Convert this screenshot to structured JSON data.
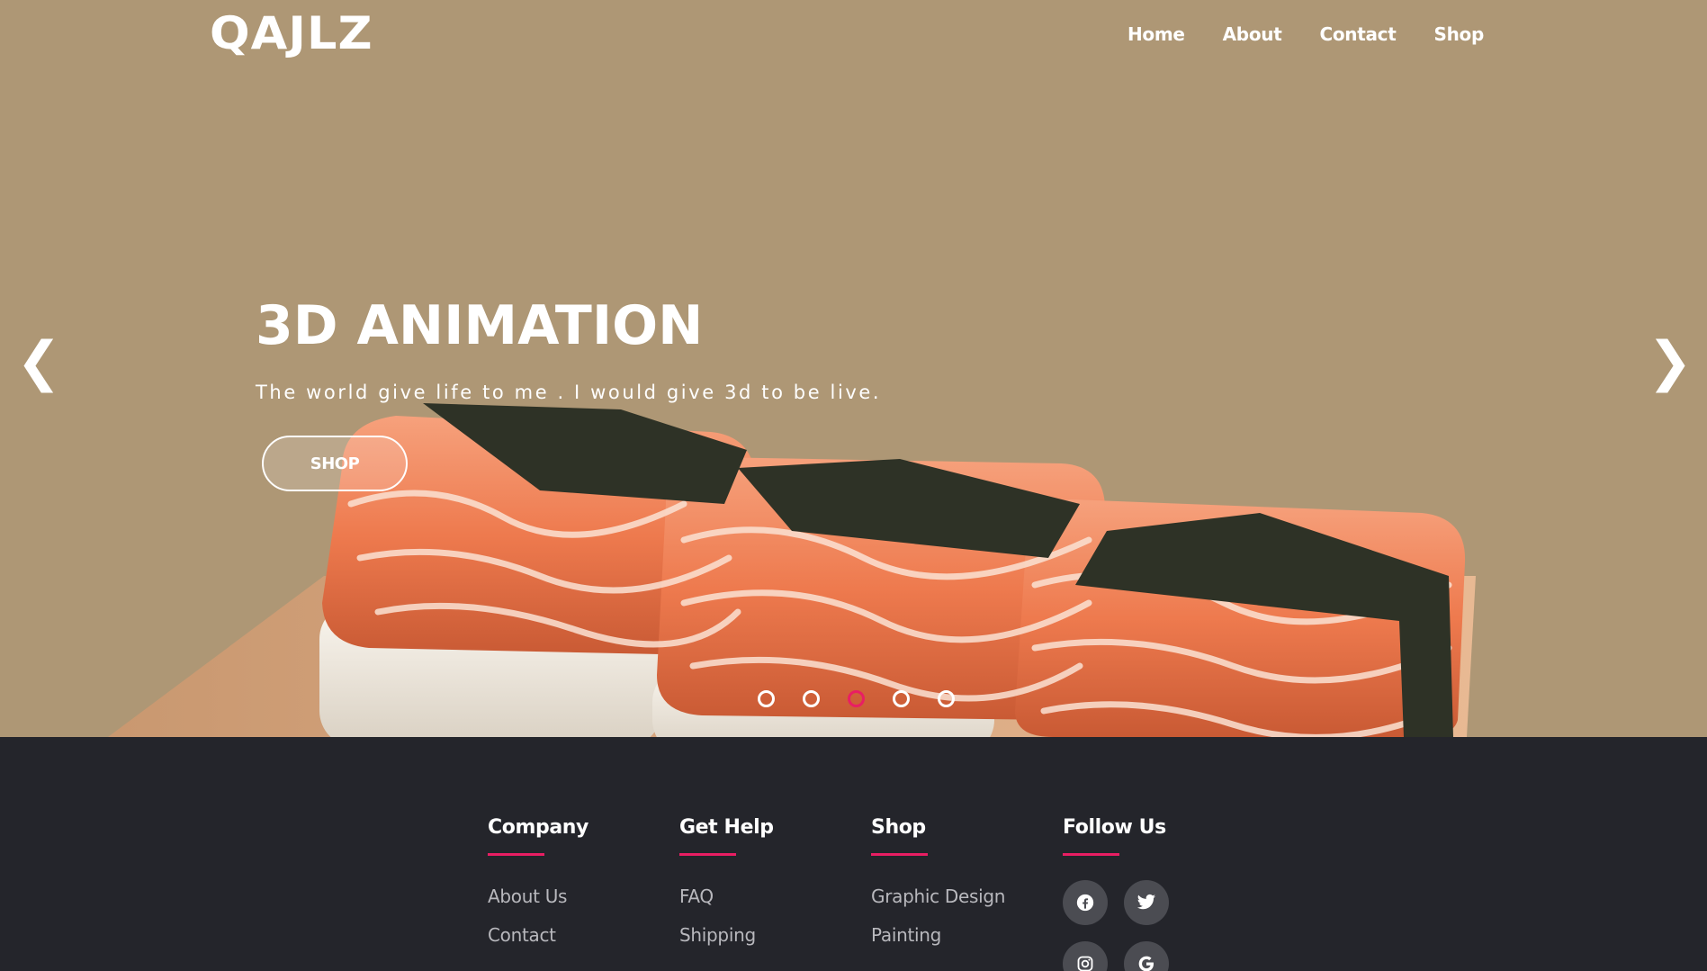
{
  "header": {
    "logo": "QAJLZ",
    "nav": [
      "Home",
      "About",
      "Contact",
      "Shop"
    ]
  },
  "hero": {
    "title": "3D ANIMATION",
    "subtitle": "The world give life to me . I would give 3d to be live.",
    "button": "SHOP",
    "prev_arrow": "❮",
    "next_arrow": "❯",
    "slides_count": 5,
    "active_slide": 3,
    "background_color": "#ae9775",
    "active_dot_color": "#e91e63"
  },
  "footer": {
    "background_color": "#24252b",
    "accent_color": "#e91e63",
    "columns": [
      {
        "title": "Company",
        "links": [
          "About Us",
          "Contact"
        ]
      },
      {
        "title": "Get Help",
        "links": [
          "FAQ",
          "Shipping"
        ]
      },
      {
        "title": "Shop",
        "links": [
          "Graphic Design",
          "Painting"
        ]
      },
      {
        "title": "Follow Us",
        "social_icons": [
          "facebook-icon",
          "twitter-icon",
          "instagram-icon",
          "google-icon"
        ]
      }
    ]
  }
}
